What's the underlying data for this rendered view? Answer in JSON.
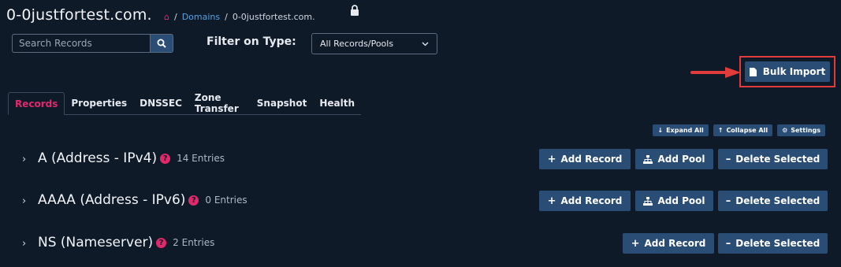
{
  "header": {
    "zone_title": "0-0justfortest.com.",
    "breadcrumb": {
      "home_icon": "home-icon",
      "sep1": "/",
      "domains_link": "Domains",
      "sep2": "/",
      "current": "0-0justfortest.com."
    },
    "lock_icon": "lock-icon"
  },
  "search": {
    "placeholder": "Search Records",
    "icon": "search-icon"
  },
  "filter": {
    "label": "Filter on Type:",
    "selected": "All Records/Pools"
  },
  "bulk_import": {
    "label": "Bulk Import",
    "icon": "file-icon"
  },
  "tabs": [
    {
      "label": "Records",
      "active": true
    },
    {
      "label": "Properties"
    },
    {
      "label": "DNSSEC"
    },
    {
      "label": "Zone Transfer"
    },
    {
      "label": "Snapshot"
    },
    {
      "label": "Health"
    }
  ],
  "toolbar": {
    "expand_all": "Expand All",
    "collapse_all": "Collapse All",
    "settings": "Settings"
  },
  "sections": [
    {
      "title": "A (Address - IPv4)",
      "entries": "14 Entries",
      "add_record": "Add Record",
      "add_pool": "Add Pool",
      "delete_selected": "Delete Selected"
    },
    {
      "title": "AAAA (Address - IPv6)",
      "entries": "0 Entries",
      "add_record": "Add Record",
      "add_pool": "Add Pool",
      "delete_selected": "Delete Selected"
    },
    {
      "title": "NS (Nameserver)",
      "entries": "2 Entries",
      "add_record": "Add Record",
      "delete_selected": "Delete Selected"
    }
  ],
  "colors": {
    "background": "#0f1a29",
    "button": "#2a4d75",
    "accent_pink": "#e0296b",
    "link_blue": "#4fa3e6",
    "highlight_red": "#e23b3b"
  }
}
